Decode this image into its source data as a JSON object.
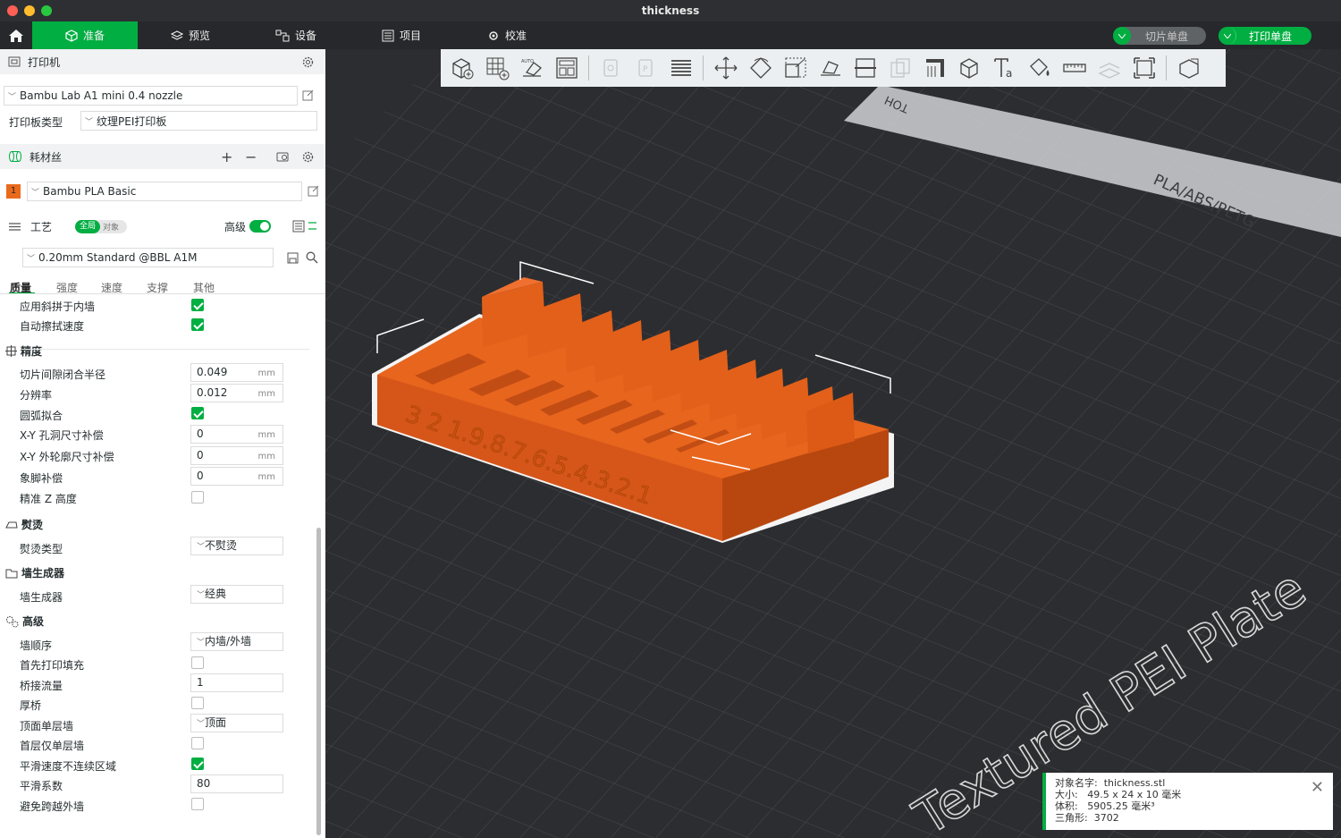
{
  "window": {
    "title": "thickness"
  },
  "tabs": [
    {
      "label": "准备",
      "icon": "cube-icon",
      "active": true
    },
    {
      "label": "预览",
      "icon": "layers-icon"
    },
    {
      "label": "设备",
      "icon": "device-icon"
    },
    {
      "label": "项目",
      "icon": "project-icon"
    },
    {
      "label": "校准",
      "icon": "calibration-icon"
    }
  ],
  "actions": {
    "slice_label": "切片单盘",
    "print_label": "打印单盘"
  },
  "printer": {
    "section_title": "打印机",
    "name": "Bambu Lab A1 mini 0.4 nozzle",
    "plate_type_label": "打印板类型",
    "plate_type": "纹理PEI打印板"
  },
  "filament": {
    "section_title": "耗材丝",
    "slot": "1",
    "slot_color": "#ea6a1c",
    "name": "Bambu PLA Basic"
  },
  "process": {
    "section_title": "工艺",
    "scope_global": "全局",
    "scope_object": "对象",
    "advanced_label": "高级",
    "preset": "0.20mm Standard @BBL A1M",
    "subtabs": [
      "质量",
      "强度",
      "速度",
      "支撑",
      "其他"
    ]
  },
  "settings": {
    "top_rows": [
      {
        "label": "应用斜拼于内墙",
        "checked": true
      },
      {
        "label": "自动擦拭速度",
        "checked": true
      }
    ],
    "precision": {
      "title": "精度",
      "gap_radius": {
        "label": "切片间隙闭合半径",
        "value": "0.049",
        "unit": "mm"
      },
      "resolution": {
        "label": "分辨率",
        "value": "0.012",
        "unit": "mm"
      },
      "arc_fitting": {
        "label": "圆弧拟合",
        "checked": true
      },
      "xy_hole": {
        "label": "X-Y 孔洞尺寸补偿",
        "value": "0",
        "unit": "mm"
      },
      "xy_contour": {
        "label": "X-Y 外轮廓尺寸补偿",
        "value": "0",
        "unit": "mm"
      },
      "elephant_foot": {
        "label": "象脚补偿",
        "value": "0",
        "unit": "mm"
      },
      "precise_z": {
        "label": "精准 Z 高度",
        "checked": false
      }
    },
    "ironing": {
      "title": "熨烫",
      "type_label": "熨烫类型",
      "type_value": "不熨烫"
    },
    "wall_generator": {
      "title": "墙生成器",
      "label": "墙生成器",
      "value": "经典"
    },
    "advanced": {
      "title": "高级",
      "wall_order": {
        "label": "墙顺序",
        "value": "内墙/外墙"
      },
      "infill_first": {
        "label": "首先打印填充",
        "checked": false
      },
      "bridge_flow": {
        "label": "桥接流量",
        "value": "1"
      },
      "thick_bridges": {
        "label": "厚桥",
        "checked": false
      },
      "top_one_wall": {
        "label": "顶面单层墙",
        "value": "顶面"
      },
      "first_layer_one_wall": {
        "label": "首层仅单层墙",
        "checked": false
      },
      "smooth_speed": {
        "label": "平滑速度不连续区域",
        "checked": true
      },
      "smooth_coef": {
        "label": "平滑系数",
        "value": "80"
      },
      "avoid_crossing": {
        "label": "避免跨越外墙",
        "checked": false
      }
    }
  },
  "plate": {
    "label": "Textured PEI Plate",
    "material_strip": "PLA/ABS/PETG",
    "hot_label": "HOT",
    "model_color": "#e2601a",
    "model_numbers": "3 2 1.9.8.7.6.5.4.3.2.1"
  },
  "object_info": {
    "name_label": "对象名字:",
    "name": "thickness.stl",
    "size_label": "大小:",
    "size": "49.5 x 24 x 10 毫米",
    "volume_label": "体积:",
    "volume": "5905.25 毫米³",
    "triangles_label": "三角形:",
    "triangles": "3702"
  }
}
